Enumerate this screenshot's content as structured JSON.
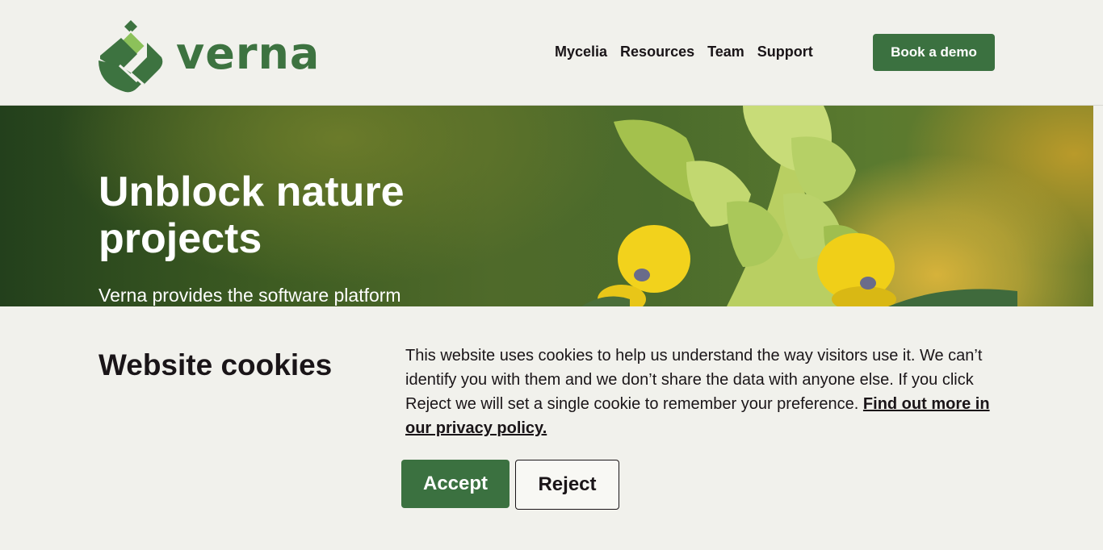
{
  "brand": {
    "name": "verna",
    "color": "#3d7340"
  },
  "nav": {
    "items": [
      {
        "label": "Mycelia"
      },
      {
        "label": "Resources"
      },
      {
        "label": "Team"
      },
      {
        "label": "Support"
      }
    ],
    "cta_label": "Book a demo"
  },
  "hero": {
    "title": "Unblock nature projects",
    "subtitle": "Verna provides the software platform"
  },
  "cookie_banner": {
    "title": "Website cookies",
    "text": "This website uses cookies to help us understand the way visitors use it. We can’t identify you with them and we don’t share the data with anyone else. If you click Reject we will set a single cookie to remember your preference.",
    "link_label": "Find out more in our privacy policy.",
    "accept_label": "Accept",
    "reject_label": "Reject"
  },
  "colors": {
    "accent": "#3b7140",
    "background": "#f1f1ec",
    "text": "#1a1518"
  }
}
